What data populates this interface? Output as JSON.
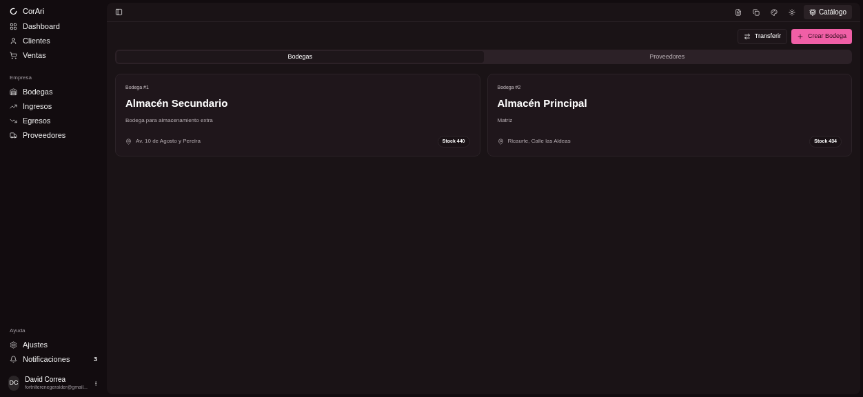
{
  "sidebar": {
    "brand": "CorAri",
    "items": [
      {
        "label": "Dashboard"
      },
      {
        "label": "Clientes"
      },
      {
        "label": "Ventas"
      }
    ],
    "sections": [
      {
        "title": "Empresa",
        "items": [
          {
            "label": "Bodegas"
          },
          {
            "label": "Ingresos"
          },
          {
            "label": "Egresos"
          },
          {
            "label": "Proveedores"
          }
        ]
      }
    ],
    "help": {
      "title": "Ayuda",
      "items": [
        {
          "label": "Ajustes"
        },
        {
          "label": "Notificaciones",
          "badge": "3"
        }
      ]
    },
    "user": {
      "initials": "DC",
      "name": "David Correa",
      "email": "fortniterenegeraider@gmail..."
    }
  },
  "topbar": {
    "catalog_button": "Catálogo"
  },
  "actions": {
    "transfer": "Transferir",
    "create": "Crear Bodega"
  },
  "tabs": [
    {
      "label": "Bodegas",
      "selected": true
    },
    {
      "label": "Proveedores",
      "selected": false
    }
  ],
  "warehouses": [
    {
      "number": "Bodega #1",
      "name": "Almacén Secundario",
      "description": "Bodega para almacenamiento extra",
      "address": "Av. 10 de Agosto y Pereira",
      "stock": "Stock 440"
    },
    {
      "number": "Bodega #2",
      "name": "Almacén Principal",
      "description": "Matriz",
      "address": "Ricaurte, Calle las Aldeas",
      "stock": "Stock 434"
    }
  ]
}
